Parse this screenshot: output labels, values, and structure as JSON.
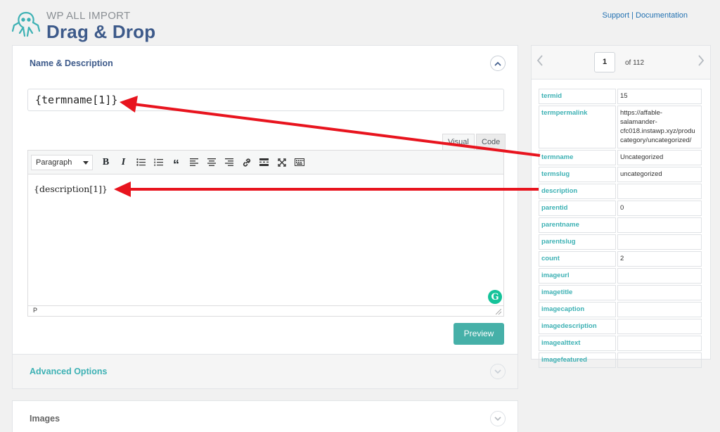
{
  "header": {
    "brand_top": "WP ALL IMPORT",
    "brand_main": "Drag & Drop",
    "support_link": "Support",
    "separator": "|",
    "docs_link": "Documentation"
  },
  "name_description": {
    "title": "Name & Description",
    "name_value": "{termname[1]}",
    "tabs": {
      "visual": "Visual",
      "code": "Code"
    },
    "toolbar": {
      "format_select": "Paragraph"
    },
    "body_text": "{description[1]}",
    "status_path": "P",
    "preview_button": "Preview"
  },
  "advanced_options": {
    "title": "Advanced Options"
  },
  "images": {
    "title": "Images"
  },
  "record_nav": {
    "current_page": "1",
    "of_label": "of 112"
  },
  "record_fields": [
    {
      "key": "termid",
      "value": "15"
    },
    {
      "key": "termpermalink",
      "value": "https://affable-\nsalamander-\ncfc018.instawp.xyz/produ\ncategory/uncategorized/"
    },
    {
      "key": "termname",
      "value": "Uncategorized"
    },
    {
      "key": "termslug",
      "value": "uncategorized"
    },
    {
      "key": "description",
      "value": ""
    },
    {
      "key": "parentid",
      "value": "0"
    },
    {
      "key": "parentname",
      "value": ""
    },
    {
      "key": "parentslug",
      "value": ""
    },
    {
      "key": "count",
      "value": "2"
    },
    {
      "key": "imageurl",
      "value": ""
    },
    {
      "key": "imagetitle",
      "value": ""
    },
    {
      "key": "imagecaption",
      "value": ""
    },
    {
      "key": "imagedescription",
      "value": ""
    },
    {
      "key": "imagealttext",
      "value": ""
    },
    {
      "key": "imagefeatured",
      "value": ""
    }
  ],
  "colors": {
    "brand_blue": "#3d5a8a",
    "teal": "#3db1b4",
    "preview_button": "#46b0a8",
    "arrow_red": "#e8141e"
  }
}
